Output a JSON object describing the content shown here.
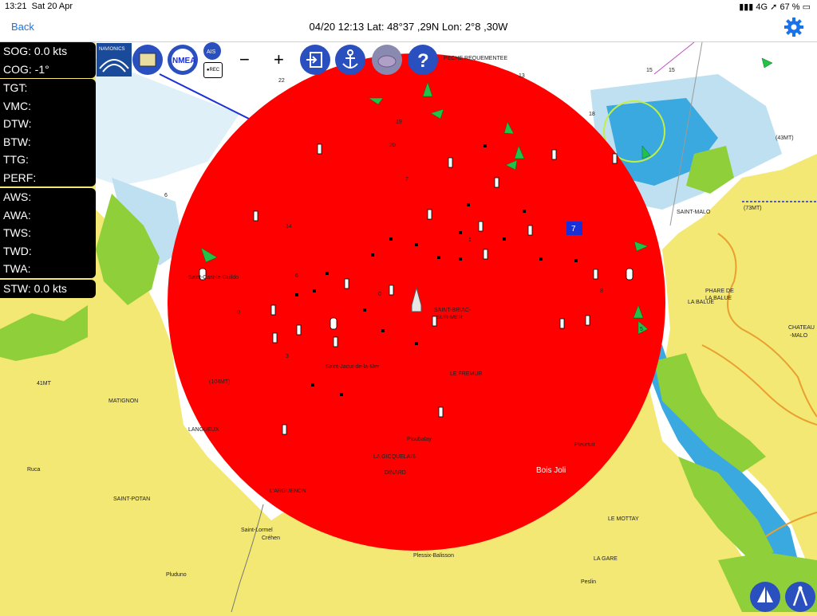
{
  "status": {
    "time": "13:21",
    "date": "Sat 20 Apr",
    "signal": "4G",
    "battery": "67 %"
  },
  "nav": {
    "back_label": "Back",
    "title": "04/20 12:13  Lat: 48°37 ,29N Lon: 2°8 ,30W"
  },
  "toolbar": {
    "minus": "−",
    "plus": "+",
    "scale": "22",
    "nmea": "NMEA",
    "ais": "AIS",
    "rec": "●REC",
    "navionics": "NAVIONICS",
    "help": "?"
  },
  "panels": {
    "speed": [
      "SOG: 0.0 kts",
      "COG: -1°"
    ],
    "nav": [
      "TGT:",
      "VMC:",
      "DTW:",
      "BTW:",
      "TTG:",
      "PERF:"
    ],
    "wind": [
      "AWS:",
      "AWA:",
      "TWS:",
      "TWD:",
      "TWA:"
    ],
    "stw": [
      "STW: 0.0 kts"
    ]
  },
  "map": {
    "places": {
      "saint_cast": "Saint-Cast-le-Guildo",
      "saint_briac": "SAINT-BRIAC-",
      "saint_briac2": "SUR-MER",
      "saint_jacut": "Saint-Jacut-de-la-Mer",
      "fremur": "LE FREMUR",
      "ploubalay": "Ploubalay",
      "gicquelais": "LA GICQUELAIS",
      "dinard": "DINARD",
      "bois_joli": "Bois Joli",
      "pleurtuit": "Pleurtuit",
      "arguenon": "L'ARGUENON",
      "matignon": "MATIGNON",
      "langueux": "LANGUEUX",
      "ruca": "Ruca",
      "saint_potan": "SAINT-POTAN",
      "saint_lormel": "Saint-Lormel",
      "crehen": "Créhen",
      "pluduno": "Pluduno",
      "plessix": "Plessix-Balisson",
      "mottay": "LE MOTTAY",
      "la_gare": "LA GARE",
      "peslin": "Peslin",
      "saint_malo": "SAINT-MALO",
      "phare": "PHARE DE",
      "phare2": "LA BALUE",
      "la_balue": "LA BALUE",
      "chateau": "CHATEAU",
      "chateau2": "-MALO",
      "mt41": "41MT",
      "mt104": "(104MT)",
      "mt73": "(73MT)",
      "mt43": "(43MT)",
      "pecheur": "PECHE REQUEMENTEE"
    },
    "soundings": [
      "19",
      "20",
      "7",
      "14",
      "6",
      "0",
      "3",
      "0",
      "6",
      "8",
      "1",
      "5",
      "15",
      "15",
      "18",
      "13",
      "22"
    ],
    "waypoint_badge": "7",
    "colors": {
      "land": "#f3e873",
      "sea": "#ffffff",
      "shallow": "#bfe0f0",
      "deep": "#3aa9e0",
      "green": "#8fcf3a",
      "alarm": "#ff0000"
    }
  }
}
